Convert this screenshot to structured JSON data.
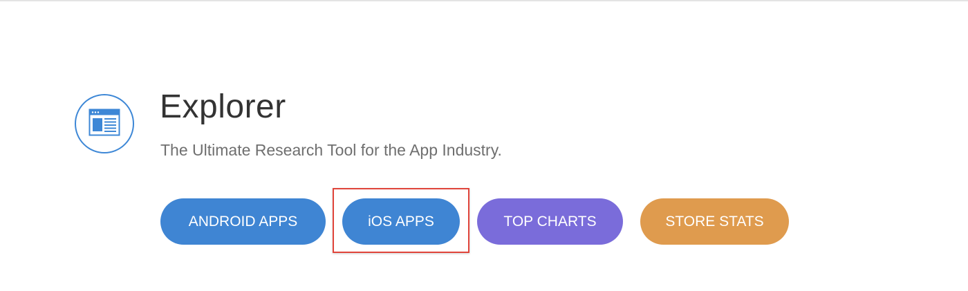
{
  "header": {
    "logo_icon": "browser-window-icon",
    "title": "Explorer",
    "subtitle": "The Ultimate Research Tool for the App Industry."
  },
  "actions": {
    "android_apps": "ANDROID APPS",
    "ios_apps": "iOS APPS",
    "top_charts": "TOP CHARTS",
    "store_stats": "STORE STATS"
  },
  "colors": {
    "primary_blue": "#3f85d3",
    "purple": "#7a6cda",
    "orange": "#df9b4e",
    "highlight": "#e0443a"
  }
}
